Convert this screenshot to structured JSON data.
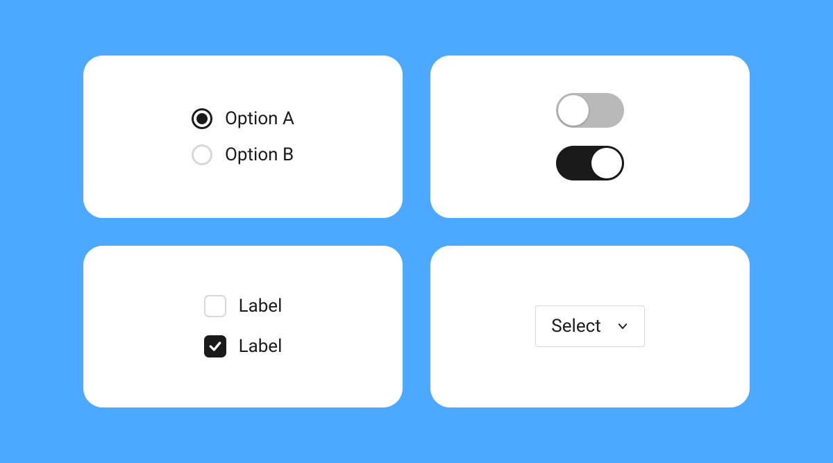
{
  "radio": {
    "options": [
      {
        "label": "Option A",
        "selected": true
      },
      {
        "label": "Option B",
        "selected": false
      }
    ]
  },
  "checkbox": {
    "items": [
      {
        "label": "Label",
        "checked": false
      },
      {
        "label": "Label",
        "checked": true
      }
    ]
  },
  "toggles": {
    "items": [
      {
        "state": "off"
      },
      {
        "state": "on"
      }
    ]
  },
  "select": {
    "placeholder": "Select"
  }
}
